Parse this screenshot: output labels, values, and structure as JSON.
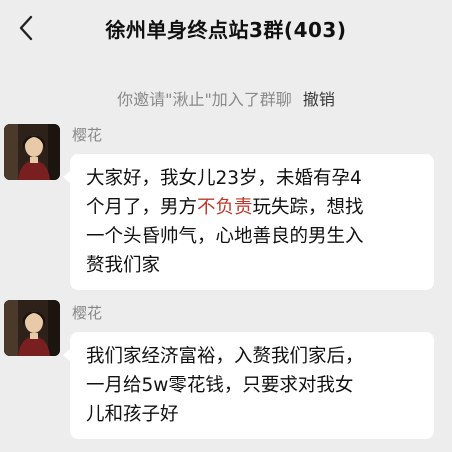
{
  "header": {
    "title": "徐州单身终点站3群(403)",
    "back_icon": "chevron-left-icon"
  },
  "system_message": {
    "text": "你邀请\"湫止\"加入了群聊",
    "undo_label": "撤销"
  },
  "messages": [
    {
      "sender": "樱花",
      "lines": [
        "大家好，我女儿23岁，未婚有孕4",
        "个月了，男方不负责玩失踪，想找",
        "一个头昏帅气，心地善良的男生入",
        "赘我们家"
      ],
      "highlight": "不负责"
    },
    {
      "sender": "樱花",
      "lines": [
        "我们家经济富裕，入赘我们家后，",
        "一月给5w零花钱，只要求对我女",
        "儿和孩子好"
      ]
    }
  ],
  "colors": {
    "background": "#ededed",
    "bubble": "#ffffff",
    "highlight": "#c0392b"
  }
}
